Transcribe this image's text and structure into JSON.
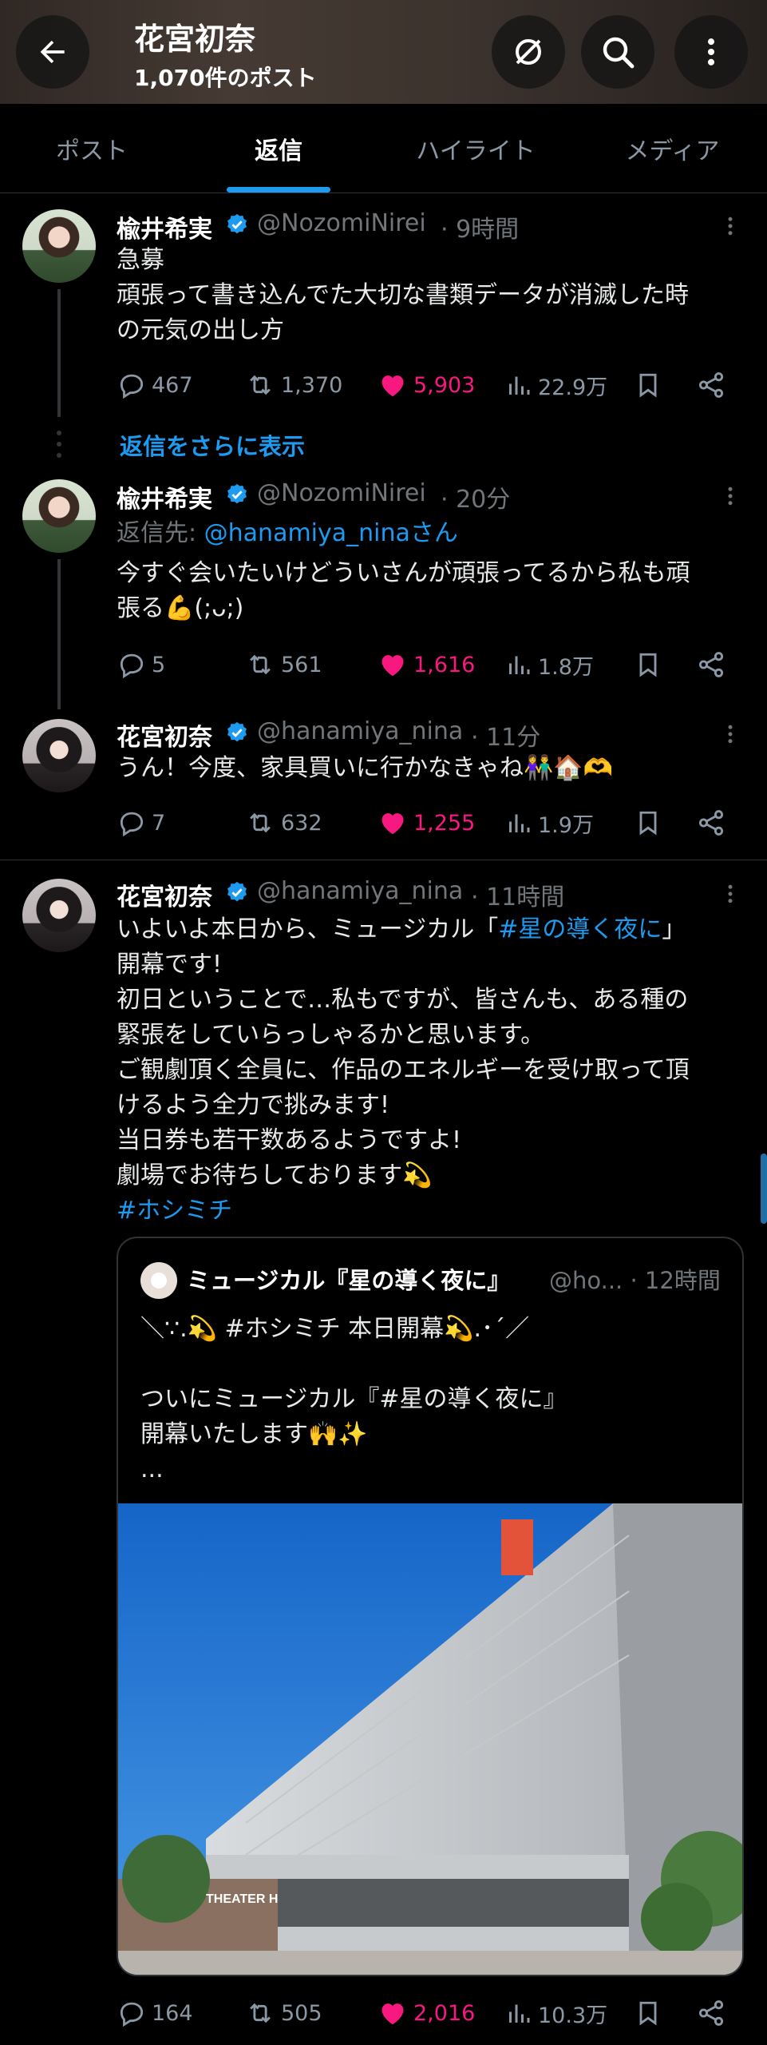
{
  "header": {
    "title": "花宮初奈",
    "post_count": "1,070件のポスト",
    "back_icon": "arrow-left-icon",
    "icons": [
      "unfollow-slash-icon",
      "search-icon",
      "more-vertical-icon"
    ]
  },
  "tabs": [
    {
      "label": "ポスト",
      "active": false
    },
    {
      "label": "返信",
      "active": true
    },
    {
      "label": "ハイライト",
      "active": false
    },
    {
      "label": "メディア",
      "active": false
    }
  ],
  "tweets": [
    {
      "name": "楡井希実",
      "handle": "@NozomiNirei",
      "time": "· 9時間",
      "lines": [
        "急募",
        "頑張って書き込んでた大切な書類データが消滅した時",
        "の元気の出し方"
      ],
      "replies": "467",
      "retweets": "1,370",
      "likes": "5,903",
      "views": "22.9万"
    },
    {
      "name": "楡井希実",
      "handle": "@NozomiNirei",
      "time": "· 20分",
      "reply_to_label": "返信先: ",
      "reply_to_handle": "@hanamiya_ninaさん",
      "lines": [
        "今すぐ会いたいけどういさんが頑張ってるから私も頑",
        "張る💪(;ᴗ;)"
      ],
      "replies": "5",
      "retweets": "561",
      "likes": "1,616",
      "views": "1.8万"
    },
    {
      "name": "花宮初奈",
      "handle": "@hanamiya_nina",
      "time": "· 11分",
      "lines": [
        "うん！今度、家具買いに行かなきゃね👫🏠🫶"
      ],
      "replies": "7",
      "retweets": "632",
      "likes": "1,255",
      "views": "1.9万"
    },
    {
      "name": "花宮初奈",
      "handle": "@hanamiya_nina",
      "time": "· 11時間",
      "line1_prefix": "いよいよ本日から、ミュージカル「",
      "line1_link": "#星の導く夜に",
      "line1_suffix": "」",
      "lines": [
        "開幕です!",
        "初日ということで…私もですが、皆さんも、ある種の",
        "緊張をしていらっしゃるかと思います。",
        "ご観劇頂く全員に、作品のエネルギーを受け取って頂",
        "けるよう全力で挑みます!",
        "当日券も若干数あるようですよ!",
        "劇場でお待ちしております💫"
      ],
      "hashtag": "#ホシミチ",
      "replies": "164",
      "retweets": "505",
      "likes": "2,016",
      "views": "10.3万"
    }
  ],
  "show_more_replies": "返信をさらに表示",
  "quote": {
    "name": "ミュージカル『星の導く夜に』",
    "handle": "@ho... · 12時間",
    "lines": [
      "＼∵.💫 #ホシミチ 本日開幕💫.･´／",
      "",
      "ついにミュージカル『#星の導く夜に』",
      "開幕いたします🙌✨",
      "..."
    ],
    "photo_sign": "THEATER H"
  },
  "colors": {
    "accent": "#1d9bf0",
    "like": "#f91880",
    "muted": "#71767b",
    "border": "#2f3336"
  }
}
